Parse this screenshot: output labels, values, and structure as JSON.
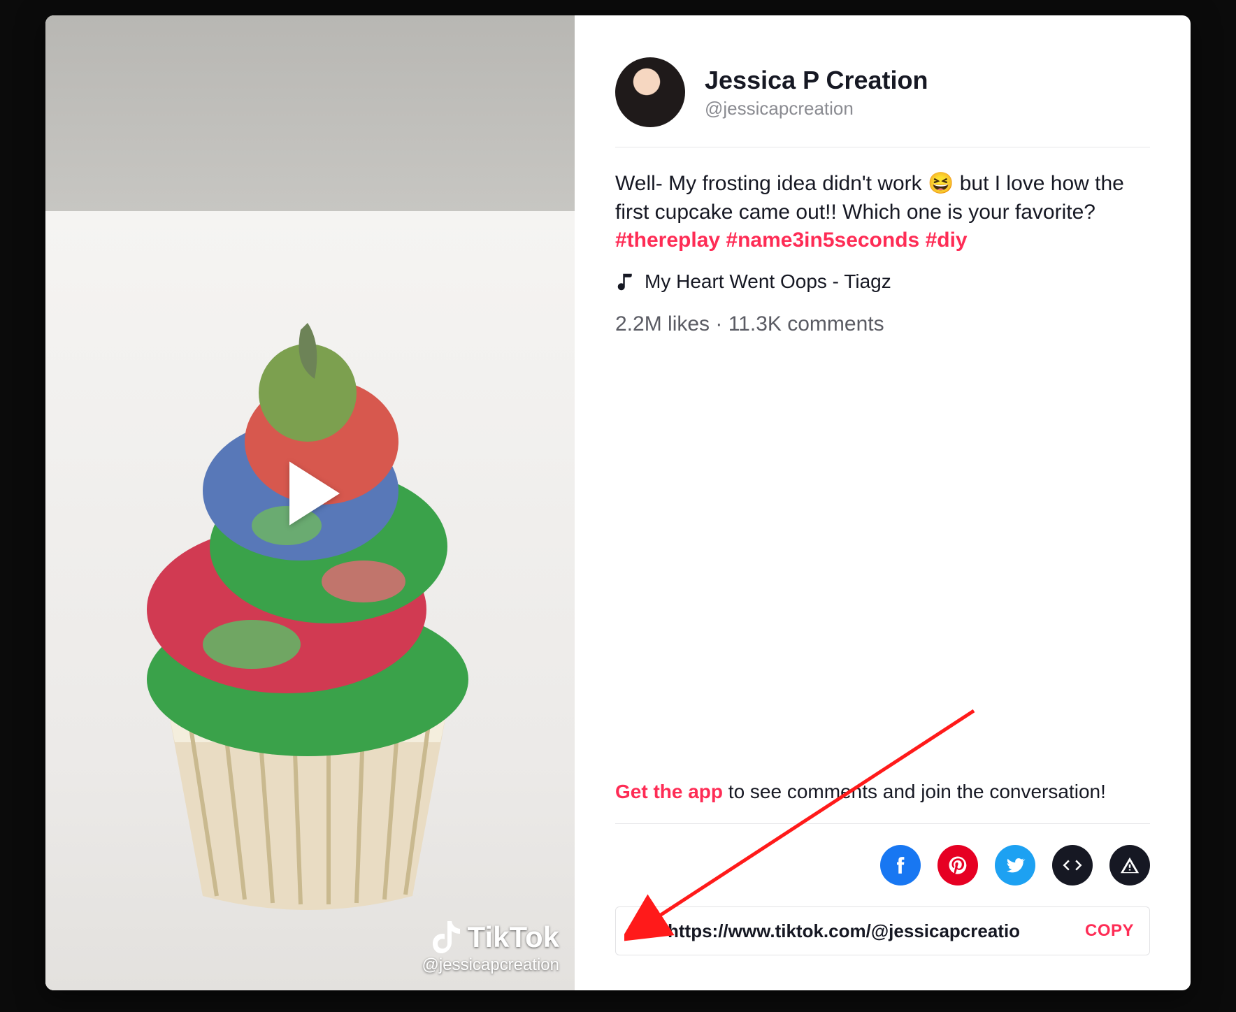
{
  "brand": {
    "name": "TikTok",
    "video_handle": "@jessicapcreation"
  },
  "creator": {
    "name": "Jessica P Creation",
    "handle": "@jessicapcreation"
  },
  "caption": {
    "text_before": "Well- My frosting idea didn't work ",
    "emoji": "😆",
    "text_after": "  but I love how the first cupcake came out!! Which one is your favorite? ",
    "hashtags": [
      "#thereplay",
      "#name3in5seconds",
      "#diy"
    ]
  },
  "music": {
    "label": "My Heart Went Oops - Tiagz"
  },
  "stats": {
    "likes": "2.2M likes",
    "sep": " · ",
    "comments": "11.3K comments"
  },
  "cta": {
    "link_text": "Get the app",
    "rest": " to see comments and join the conversation!"
  },
  "share": {
    "url": "https://www.tiktok.com/@jessicapcreatio",
    "copy_label": "COPY"
  }
}
